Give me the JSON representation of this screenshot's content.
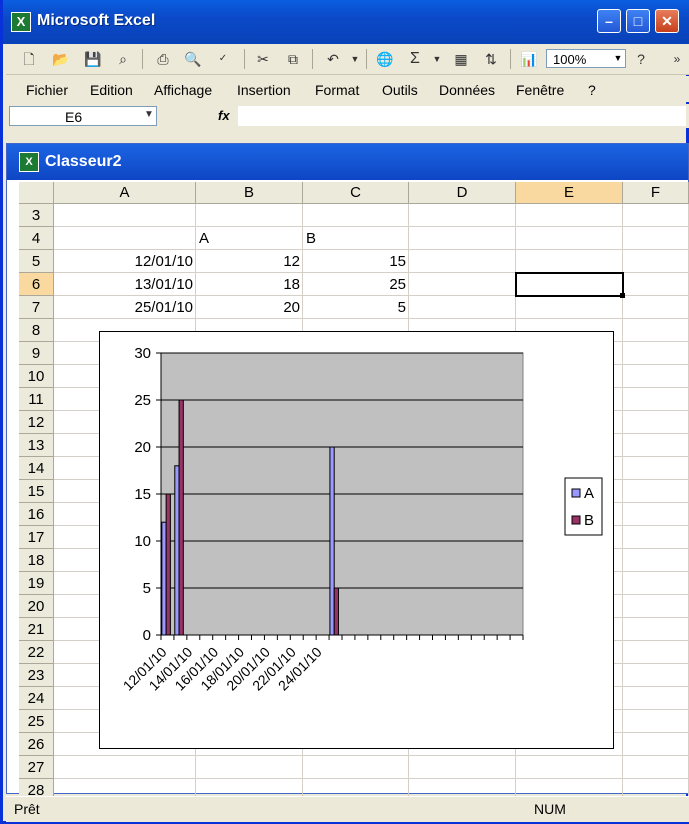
{
  "window": {
    "title": "Microsoft Excel"
  },
  "toolbar": {
    "zoom": "100%",
    "icons": [
      "new-icon",
      "open-icon",
      "save-icon",
      "permission-icon",
      "print-icon",
      "print-preview-icon",
      "spelling-icon",
      "cut-icon",
      "copy-icon",
      "undo-icon",
      "hyperlink-icon",
      "autosum-icon",
      "research-icon",
      "sort-icon",
      "chart-wizard-icon",
      "help-icon"
    ]
  },
  "menu": [
    "Fichier",
    "Edition",
    "Affichage",
    "Insertion",
    "Format",
    "Outils",
    "Données",
    "Fenêtre",
    "?"
  ],
  "formula_bar": {
    "name_box": "E6",
    "fx": "fx",
    "value": ""
  },
  "workbook": {
    "title": "Classeur2",
    "columns": [
      "A",
      "B",
      "C",
      "D",
      "E",
      "F"
    ],
    "selected_column": "E",
    "rows": [
      "3",
      "4",
      "5",
      "6",
      "7",
      "8",
      "9",
      "10",
      "11",
      "12",
      "13",
      "14",
      "15",
      "16",
      "17",
      "18",
      "19",
      "20",
      "21",
      "22",
      "23",
      "24",
      "25",
      "26",
      "27",
      "28"
    ],
    "selected_row": "6",
    "cells": [
      {
        "row": "4",
        "col": "B",
        "text": "A",
        "align": "left"
      },
      {
        "row": "4",
        "col": "C",
        "text": "B",
        "align": "left"
      },
      {
        "row": "5",
        "col": "A",
        "text": "12/01/10",
        "align": "right"
      },
      {
        "row": "5",
        "col": "B",
        "text": "12",
        "align": "right"
      },
      {
        "row": "5",
        "col": "C",
        "text": "15",
        "align": "right"
      },
      {
        "row": "6",
        "col": "A",
        "text": "13/01/10",
        "align": "right"
      },
      {
        "row": "6",
        "col": "B",
        "text": "18",
        "align": "right"
      },
      {
        "row": "6",
        "col": "C",
        "text": "25",
        "align": "right"
      },
      {
        "row": "7",
        "col": "A",
        "text": "25/01/10",
        "align": "right"
      },
      {
        "row": "7",
        "col": "B",
        "text": "20",
        "align": "right"
      },
      {
        "row": "7",
        "col": "C",
        "text": "5",
        "align": "right"
      }
    ]
  },
  "chart_data": {
    "type": "bar",
    "x_axis_type": "date",
    "x": [
      "12/01/10",
      "13/01/10",
      "25/01/10"
    ],
    "series": [
      {
        "name": "A",
        "values": [
          12,
          18,
          20
        ],
        "color": "#9999ff"
      },
      {
        "name": "B",
        "values": [
          15,
          25,
          5
        ],
        "color": "#993366"
      }
    ],
    "x_tick_labels": [
      "12/01/10",
      "14/01/10",
      "16/01/10",
      "18/01/10",
      "20/01/10",
      "22/01/10",
      "24/01/10"
    ],
    "y_ticks": [
      0,
      5,
      10,
      15,
      20,
      25,
      30
    ],
    "ylim": [
      0,
      30
    ],
    "grid": true,
    "plot_background": "#c0c0c0",
    "legend": "right"
  },
  "status": {
    "left": "Prêt",
    "num": "NUM"
  }
}
